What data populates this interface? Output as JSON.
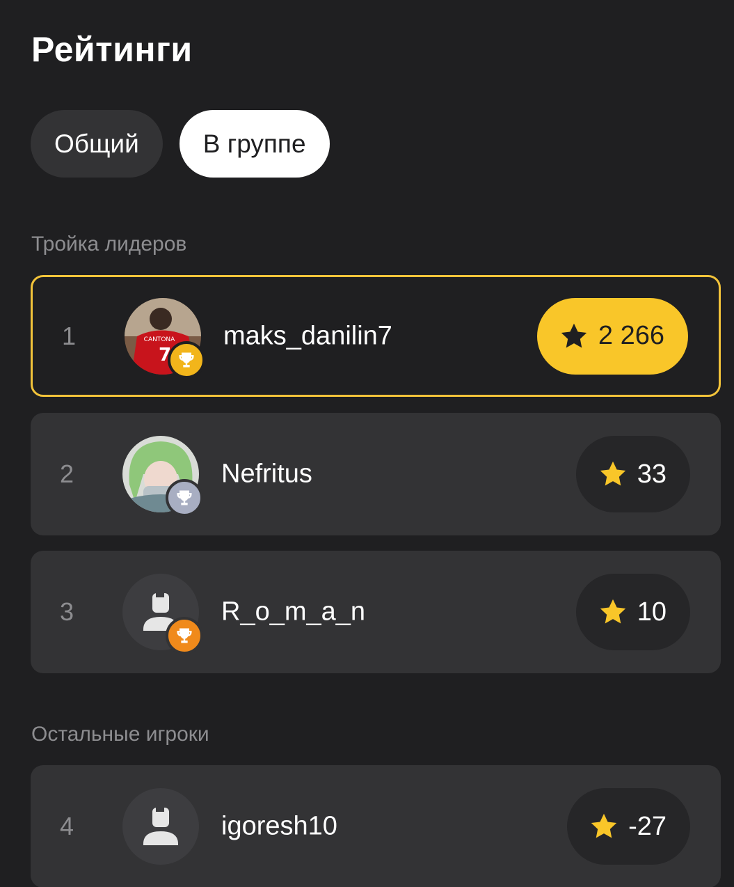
{
  "header": {
    "title": "Рейтинги"
  },
  "tabs": [
    {
      "label": "Общий",
      "active": false
    },
    {
      "label": "В группе",
      "active": true
    }
  ],
  "sections": {
    "leaders_label": "Тройка лидеров",
    "others_label": "Остальные игроки"
  },
  "players": [
    {
      "rank": "1",
      "username": "maks_danilin7",
      "score": "2 266",
      "trophy": "gold",
      "avatar": "photo-red-jersey"
    },
    {
      "rank": "2",
      "username": "Nefritus",
      "score": "33",
      "trophy": "silver",
      "avatar": "photo-green-hair"
    },
    {
      "rank": "3",
      "username": "R_o_m_a_n",
      "score": "10",
      "trophy": "bronze",
      "avatar": "default-user"
    },
    {
      "rank": "4",
      "username": "igoresh10",
      "score": "-27",
      "trophy": null,
      "avatar": "default-user"
    }
  ],
  "colors": {
    "background": "#1f1f21",
    "card": "#333335",
    "accent_gold": "#f9c629",
    "leader_border": "#f2c33a",
    "muted_text": "#8d8d90",
    "trophy_gold": "#f2b51b",
    "trophy_silver": "#a8aec2",
    "trophy_bronze": "#f08a1b"
  },
  "icons": {
    "score": "star-icon",
    "badge": "trophy-icon",
    "placeholder_avatar": "user-icon"
  }
}
